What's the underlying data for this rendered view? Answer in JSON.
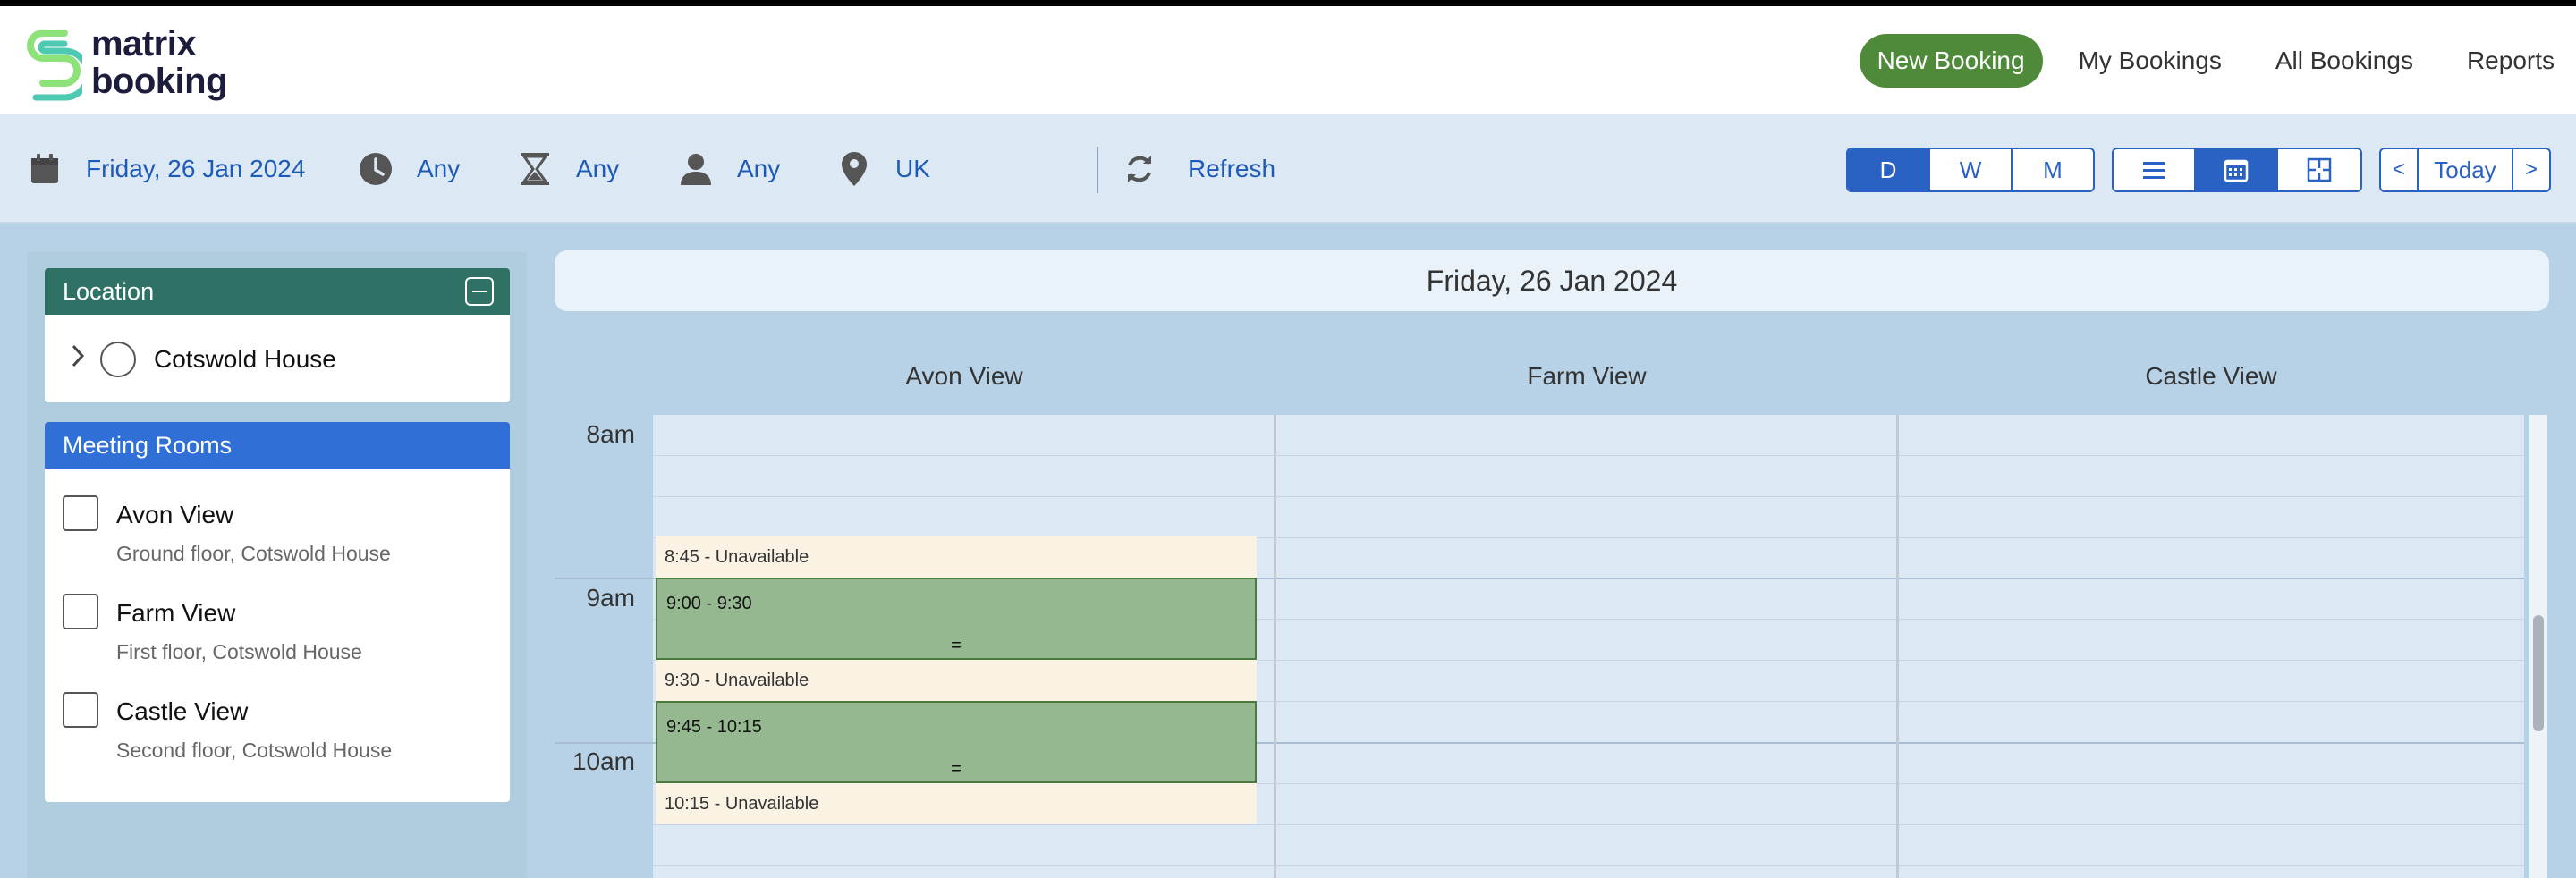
{
  "app": {
    "logo_line1": "matrix",
    "logo_line2": "booking"
  },
  "nav": {
    "items": [
      {
        "label": "New Booking",
        "active": true
      },
      {
        "label": "My Bookings"
      },
      {
        "label": "All Bookings"
      },
      {
        "label": "Reports"
      }
    ]
  },
  "filters": {
    "date": {
      "icon": "calendar-icon",
      "label": "Friday, 26 Jan 2024"
    },
    "time": {
      "icon": "clock-icon",
      "label": "Any"
    },
    "duration": {
      "icon": "hourglass-icon",
      "label": "Any"
    },
    "person": {
      "icon": "person-icon",
      "label": "Any"
    },
    "location": {
      "icon": "map-pin-icon",
      "label": "UK"
    },
    "refresh": {
      "icon": "refresh-icon",
      "label": "Refresh"
    }
  },
  "view_toggle": {
    "options": [
      "D",
      "W",
      "M"
    ],
    "active": "D"
  },
  "layout_toggle": {
    "options": [
      "list-icon",
      "calendar-icon",
      "floorplan-icon"
    ],
    "active": "calendar-icon"
  },
  "date_nav": {
    "prev": "<",
    "today": "Today",
    "next": ">"
  },
  "sidebar": {
    "location_panel": {
      "title": "Location",
      "items": [
        {
          "name": "Cotswold House"
        }
      ]
    },
    "rooms_panel": {
      "title": "Meeting Rooms",
      "rooms": [
        {
          "name": "Avon View",
          "sub": "Ground floor, Cotswold House"
        },
        {
          "name": "Farm View",
          "sub": "First floor, Cotswold House"
        },
        {
          "name": "Castle View",
          "sub": "Second floor, Cotswold House"
        }
      ]
    }
  },
  "calendar": {
    "date_label": "Friday, 26 Jan 2024",
    "columns": [
      "Avon View",
      "Farm View",
      "Castle View"
    ],
    "hours": [
      "8am",
      "9am",
      "10am"
    ],
    "events": [
      {
        "label": "8:45 - Unavailable",
        "type": "unavailable"
      },
      {
        "label": "9:00 - 9:30",
        "type": "booked",
        "handle": "="
      },
      {
        "label": "9:30 - Unavailable",
        "type": "unavailable"
      },
      {
        "label": "9:45 - 10:15",
        "type": "booked",
        "handle": "="
      },
      {
        "label": "10:15 - Unavailable",
        "type": "unavailable"
      }
    ]
  },
  "colors": {
    "brand_green": "#4f8a3a",
    "accent_blue": "#2a62c3",
    "location_header": "#2f7265",
    "rooms_header": "#2f6fd6",
    "booked": "#96b890",
    "unavailable": "#faf3e4"
  }
}
